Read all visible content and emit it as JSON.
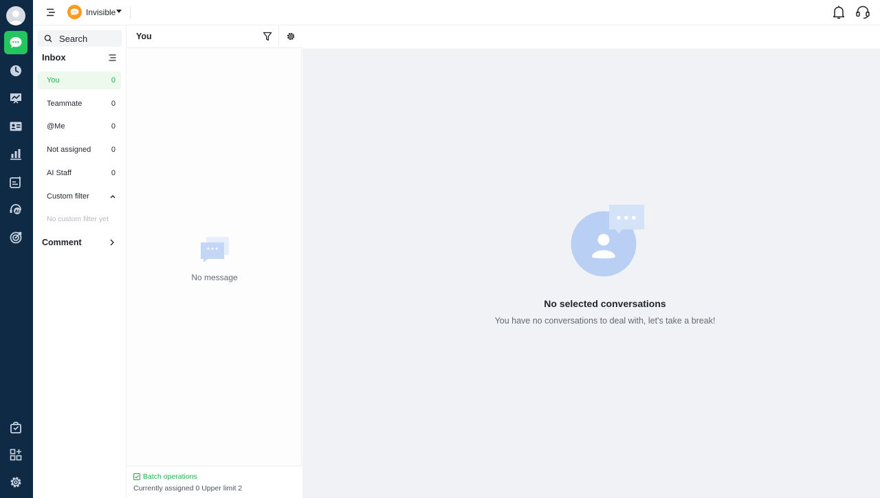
{
  "topbar": {
    "status_label": "Invisible"
  },
  "inbox": {
    "search_label": "Search",
    "title": "Inbox",
    "items": [
      {
        "label": "You",
        "count": "0"
      },
      {
        "label": "Teammate",
        "count": "0"
      },
      {
        "label": "@Me",
        "count": "0"
      },
      {
        "label": "Not assigned",
        "count": "0"
      },
      {
        "label": "AI Staff",
        "count": "0"
      }
    ],
    "custom_filter_label": "Custom filter",
    "custom_filter_empty": "No custom filter yet",
    "comment_label": "Comment"
  },
  "list": {
    "title": "You",
    "empty_text": "No message",
    "batch_label": "Batch operations",
    "assign_info": "Currently assigned 0 Upper limit 2"
  },
  "main": {
    "empty_title": "No selected conversations",
    "empty_subtitle": "You have no conversations to deal with, let's take a break!"
  },
  "colors": {
    "rail": "#0f2a45",
    "accent_green": "#22c55e",
    "status_orange": "#ff9a1f",
    "main_bg": "#f1f2f5"
  },
  "icons": [
    "menu-icon",
    "bell-icon",
    "headset-icon",
    "search-icon",
    "sort-icon",
    "filter-icon",
    "gear-icon",
    "chat-icon",
    "clock-icon",
    "presentation-icon",
    "contact-card-icon",
    "bar-chart-icon",
    "sparkle-card-icon",
    "ai-voice-icon",
    "target-icon",
    "bag-icon",
    "apps-grid-icon",
    "settings-icon"
  ]
}
